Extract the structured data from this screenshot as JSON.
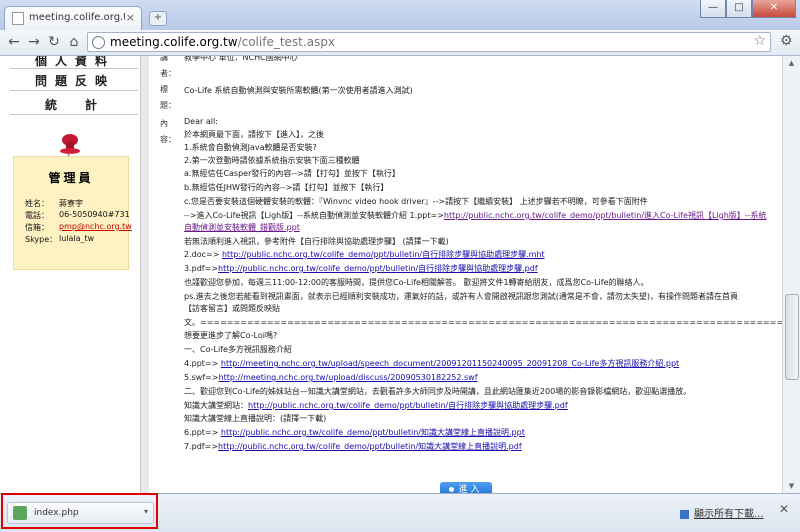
{
  "browser": {
    "tab_title": "meeting.colife.org.tw/...",
    "tab_close": "×",
    "new_tab": "+",
    "window_min": "—",
    "window_max": "□",
    "window_close": "✕",
    "url_host": "meeting.colife.org.tw",
    "url_path": "/colife_test.aspx"
  },
  "sidebar": {
    "items": [
      {
        "label": "個人資料"
      },
      {
        "label": "問題反映"
      },
      {
        "label": "統　計"
      }
    ],
    "admin": {
      "title": "管理員",
      "rows": [
        {
          "key": "姓名：",
          "value": "蔣寮宇"
        },
        {
          "key": "電話：",
          "value": "06-5050940#731"
        },
        {
          "key": "信箱：",
          "value": "pmp@nchc.org.tw"
        },
        {
          "key": "Skype：",
          "value": "lulala_tw"
        }
      ]
    }
  },
  "post": {
    "author_label": "講者：",
    "author_value": "教學中心 單位：NCHC國網中心",
    "title_label": "標題：",
    "title_value": "Co-Life 系統自動偵測與安裝所需軟體(第一次使用者請進入測試)",
    "content_label": "內容：",
    "body": [
      {
        "text": "Dear all:"
      },
      {
        "text": "於本網頁最下面，請按下【進入】，之後"
      },
      {
        "text": "1.系統會自動偵測Java軟體是否安裝?"
      },
      {
        "text": "2.第一次登動時請依據系統指示安裝下面三種軟體"
      },
      {
        "text": "  a.無經信任Casper發行的內容-->請【打勾】並按下【執行】"
      },
      {
        "text": "  b.無經信任JHW發行的內容-->請【打勾】並按下【執行】"
      },
      {
        "text": "  c.您是否要安裝這個硬體安裝的軟體：『Winvnc video hook driver』-->請按下【繼續安裝】 上述步驟若不明瞭，可參看下面附件"
      },
      {
        "text": "-->進入Co-Life視訊【Ligh版】--系統自動偵測並安裝軟體介紹  1.ppt=>",
        "link": "http://public.nchc.org.tw/colife_demo/ppt/bulletin/進入Co-Life視訊【Ligh版】--系統"
      },
      {
        "text": "",
        "link": "自動偵測並安裝軟體_錯觀版.ppt"
      },
      {
        "text": "若無法順利進入視訊，參考附件【自行排除與協助處理步驟】 (請擇一下載)"
      },
      {
        "text": "  2.doc=> ",
        "link": "http://public.nchc.org.tw/colife_demo/ppt/bulletin/自行排除步驟與協助處理步驟.mht"
      },
      {
        "text": "  3.pdf=>",
        "link": "http://public.nchc.org.tw/colife_demo/ppt/bulletin/自行排除步驟與協助處理步驟.pdf"
      },
      {
        "text": "也謹歡迎您參加，每週三11:00-12:00的客服時間，提供您Co-Life相關解答。 歡迎將文件1轉寄給朋友，成爲您Co-Life的聯絡人。"
      },
      {
        "text": "ps.進去之後您若能看到視訊畫面，就表示已經順利安裝成功，運氣好的話，或許有人會開啟視訊跟您測試(通常是不會，請勿太失望)，有操作問題者請在首頁"
      },
      {
        "text": "【訪客留言】或問題反映貼"
      },
      {
        "text": "文。=================================================================================================="
      },
      {
        "text": "想要更進步了解Co-Loi嗎?"
      },
      {
        "text": "一、Co-Life多方視訊服務介紹"
      },
      {
        "text": "4.ppt=> ",
        "link": "http://meeting.nchc.org.tw/upload/speech_document/20091201150240095_20091208_Co-Life多方視訊服務介紹.ppt"
      },
      {
        "text": "5.swf=>",
        "link": "http://meeting.nchc.org.tw/upload/discuss/20090530182252.swf"
      },
      {
        "text": "二、歡迎您到Co-Life的姊妹站台—知識大講堂網站，去觀看許多大師同步及時開講，且此網站匯集近200場的影音錄影檔網站，歡迎點選播放。"
      },
      {
        "text": "知識大講堂網站：",
        "link": "http://public.nchc.org.tw/colife_demo/ppt/bulletin/自行排除步驟與協助處理步驟.pdf"
      },
      {
        "text": "知識大講堂線上直播說明：(請擇一下載)"
      },
      {
        "text": "  6.ppt=> ",
        "link": "http://public.nchc.org.tw/colife_demo/ppt/bulletin/知識大講堂線上直播說明.ppt"
      },
      {
        "text": "  7.pdf=>",
        "link": "http://public.nchc.org.tw/colife_demo/ppt/bulletin/知識大講堂線上直播說明.pdf"
      }
    ],
    "enter_button": "進入"
  },
  "download_shelf": {
    "file_name": "index.php",
    "dropdown": "▾",
    "show_all": "顯示所有下載...",
    "close": "✕"
  }
}
